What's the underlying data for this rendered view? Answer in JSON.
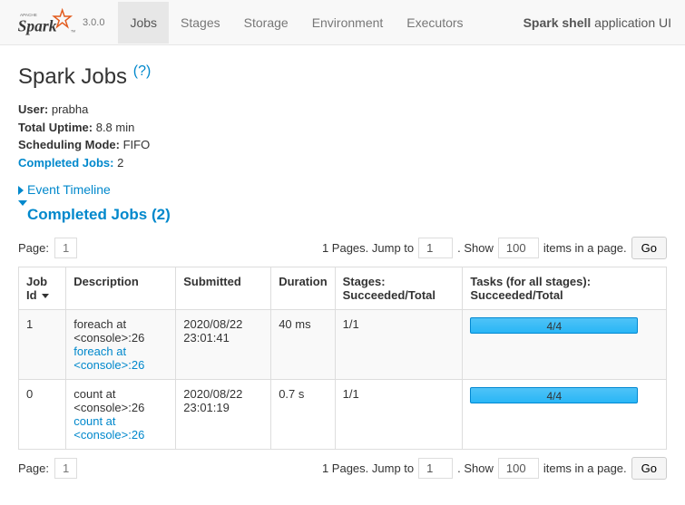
{
  "brand": {
    "version": "3.0.0"
  },
  "nav": {
    "tabs": [
      "Jobs",
      "Stages",
      "Storage",
      "Environment",
      "Executors"
    ],
    "activeIndex": 0,
    "appNamePrefix": "Spark shell",
    "appNameSuffix": " application UI"
  },
  "page": {
    "title": "Spark Jobs ",
    "helpLabel": "(?)"
  },
  "summary": {
    "userLabel": "User:",
    "user": "prabha",
    "uptimeLabel": "Total Uptime:",
    "uptime": "8.8 min",
    "schedLabel": "Scheduling Mode:",
    "sched": "FIFO",
    "completedLabel": "Completed Jobs:",
    "completed": "2"
  },
  "eventTimeline": "Event Timeline",
  "completedHeader": "Completed Jobs (2)",
  "pagination": {
    "pageLabel": "Page:",
    "currentPage": "1",
    "pagesText": "1 Pages. Jump to",
    "jumpValue": "1",
    "showPrefix": ". Show",
    "showValue": "100",
    "showSuffix": "items in a page.",
    "goLabel": "Go"
  },
  "table": {
    "headers": {
      "jobId": "Job Id",
      "description": "Description",
      "submitted": "Submitted",
      "duration": "Duration",
      "stages": "Stages: Succeeded/Total",
      "tasks": "Tasks (for all stages): Succeeded/Total"
    },
    "rows": [
      {
        "id": "1",
        "descTop": "foreach at <console>:26",
        "descLink": "foreach at <console>:26",
        "submitted": "2020/08/22 23:01:41",
        "duration": "40 ms",
        "stages": "1/1",
        "tasks": "4/4"
      },
      {
        "id": "0",
        "descTop": "count at <console>:26",
        "descLink": "count at <console>:26",
        "submitted": "2020/08/22 23:01:19",
        "duration": "0.7 s",
        "stages": "1/1",
        "tasks": "4/4"
      }
    ]
  },
  "chart_data": {
    "type": "table",
    "title": "Completed Jobs",
    "columns": [
      "Job Id",
      "Description",
      "Submitted",
      "Duration",
      "Stages Succeeded/Total",
      "Tasks Succeeded/Total"
    ],
    "rows": [
      [
        1,
        "foreach at <console>:26",
        "2020/08/22 23:01:41",
        "40 ms",
        "1/1",
        "4/4"
      ],
      [
        0,
        "count at <console>:26",
        "2020/08/22 23:01:19",
        "0.7 s",
        "1/1",
        "4/4"
      ]
    ]
  }
}
